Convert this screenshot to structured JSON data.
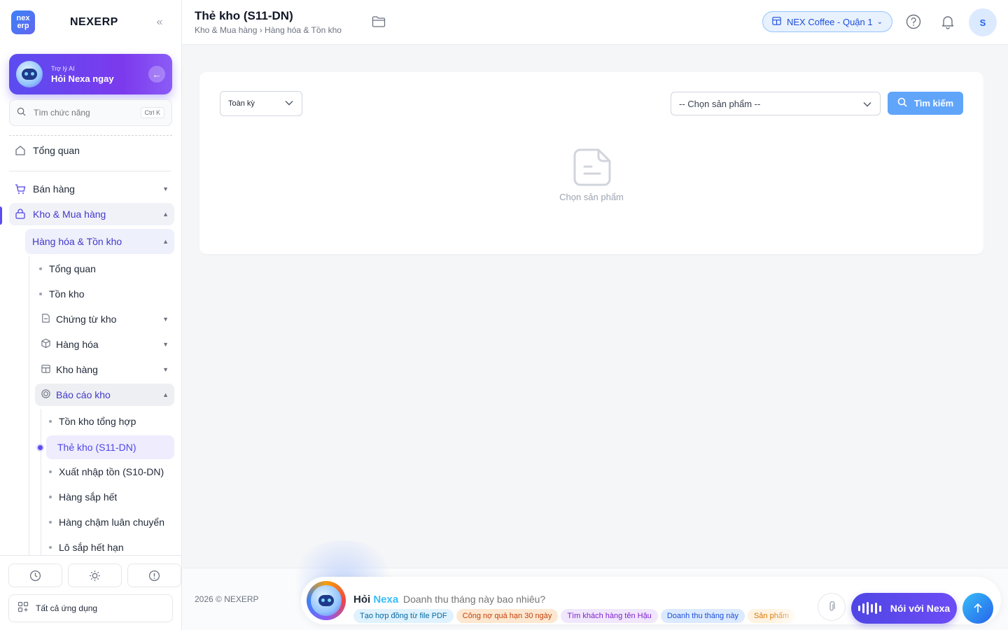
{
  "brand": {
    "logo_top": "nex",
    "logo_bottom": "erp",
    "name": "NEXERP"
  },
  "ai_card": {
    "subtitle": "Trợ lý AI",
    "title": "Hỏi Nexa ngay"
  },
  "search": {
    "placeholder": "Tìm chức năng",
    "shortcut": "Ctrl K"
  },
  "nav": {
    "overview": "Tổng quan",
    "sales": "Bán hàng",
    "warehouse": "Kho & Mua hàng",
    "goods_stock": "Hàng hóa & Tồn kho",
    "items": {
      "overview": "Tổng quan",
      "stock": "Tồn kho",
      "documents": "Chứng từ kho",
      "goods": "Hàng hóa",
      "warehouses": "Kho hàng",
      "reports": "Báo cáo kho"
    },
    "reports": {
      "summary": "Tồn kho tổng hợp",
      "stock_card": "Thẻ kho (S11-DN)",
      "in_out": "Xuất nhập tồn (S10-DN)",
      "low_stock": "Hàng sắp hết",
      "slow_moving": "Hàng chậm luân chuyển",
      "expiring": "Lô sắp hết hạn"
    }
  },
  "sidebar_bottom": {
    "all_apps": "Tất cả ứng dụng"
  },
  "header": {
    "title": "Thẻ kho (S11-DN)",
    "breadcrumb": "Kho & Mua hàng › Hàng hóa & Tồn kho",
    "branch": "NEX Coffee - Quận 1",
    "avatar_initial": "S"
  },
  "filters": {
    "period": "Toàn kỳ",
    "product_placeholder": "-- Chọn sản phẩm --",
    "search_button": "Tìm kiếm"
  },
  "empty_state": "Chọn sản phẩm",
  "footer": {
    "copyright": "2026 © NEXERP",
    "ask_prefix": "Hỏi",
    "ask_brand": "Nexa",
    "ask_placeholder": "Doanh thu tháng này bao nhiêu?",
    "chips": [
      "Tạo hợp đồng từ file PDF",
      "Công nợ quá hạn 30 ngày",
      "Tìm khách hàng tên Hậu",
      "Doanh thu tháng này",
      "Sản phẩm"
    ],
    "talk_button": "Nói với Nexa"
  },
  "colors": {
    "primary": "#5b4cf0",
    "accent_blue": "#60a5fa",
    "active_text": "#4338ca"
  }
}
